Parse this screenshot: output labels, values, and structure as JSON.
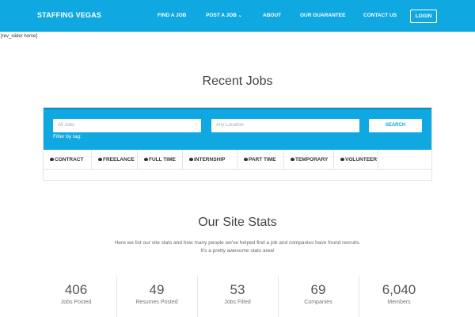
{
  "header": {
    "brand": "STAFFING VEGAS",
    "nav": [
      {
        "label": "FIND A JOB"
      },
      {
        "label": "POST A JOB"
      },
      {
        "label": "ABOUT"
      },
      {
        "label": "OUR GUARANTEE"
      },
      {
        "label": "CONTACT US"
      }
    ],
    "login": "LOGIN",
    "dropdown_icon": "chevron-down-icon"
  },
  "shortcode_text": "[rev_slider home]",
  "recent_jobs": {
    "title": "Recent Jobs",
    "keywords_placeholder": "All Jobs",
    "location_placeholder": "Any Location",
    "search_label": "SEARCH",
    "filter_label": "Filter by tag:",
    "tags": [
      "CONTRACT",
      "FREELANCE",
      "FULL TIME",
      "INTERNSHIP",
      "PART TIME",
      "TEMPORARY",
      "VOLUNTEER"
    ],
    "tag_icon": "checkbox-icon"
  },
  "site_stats": {
    "title": "Our Site Stats",
    "description": "Here we list our site stats and how many people we've helped find a job and companies have found recruits. It's a pretty awesome stats area!",
    "stats": [
      {
        "value": "406",
        "label": "Jobs Posted"
      },
      {
        "value": "49",
        "label": "Resumes Posted"
      },
      {
        "value": "53",
        "label": "Jobs Filled"
      },
      {
        "value": "69",
        "label": "Companies"
      },
      {
        "value": "6,040",
        "label": "Members"
      }
    ]
  },
  "colors": {
    "accent": "#10a8e0",
    "background": "#ffffff",
    "text": "#555555"
  }
}
